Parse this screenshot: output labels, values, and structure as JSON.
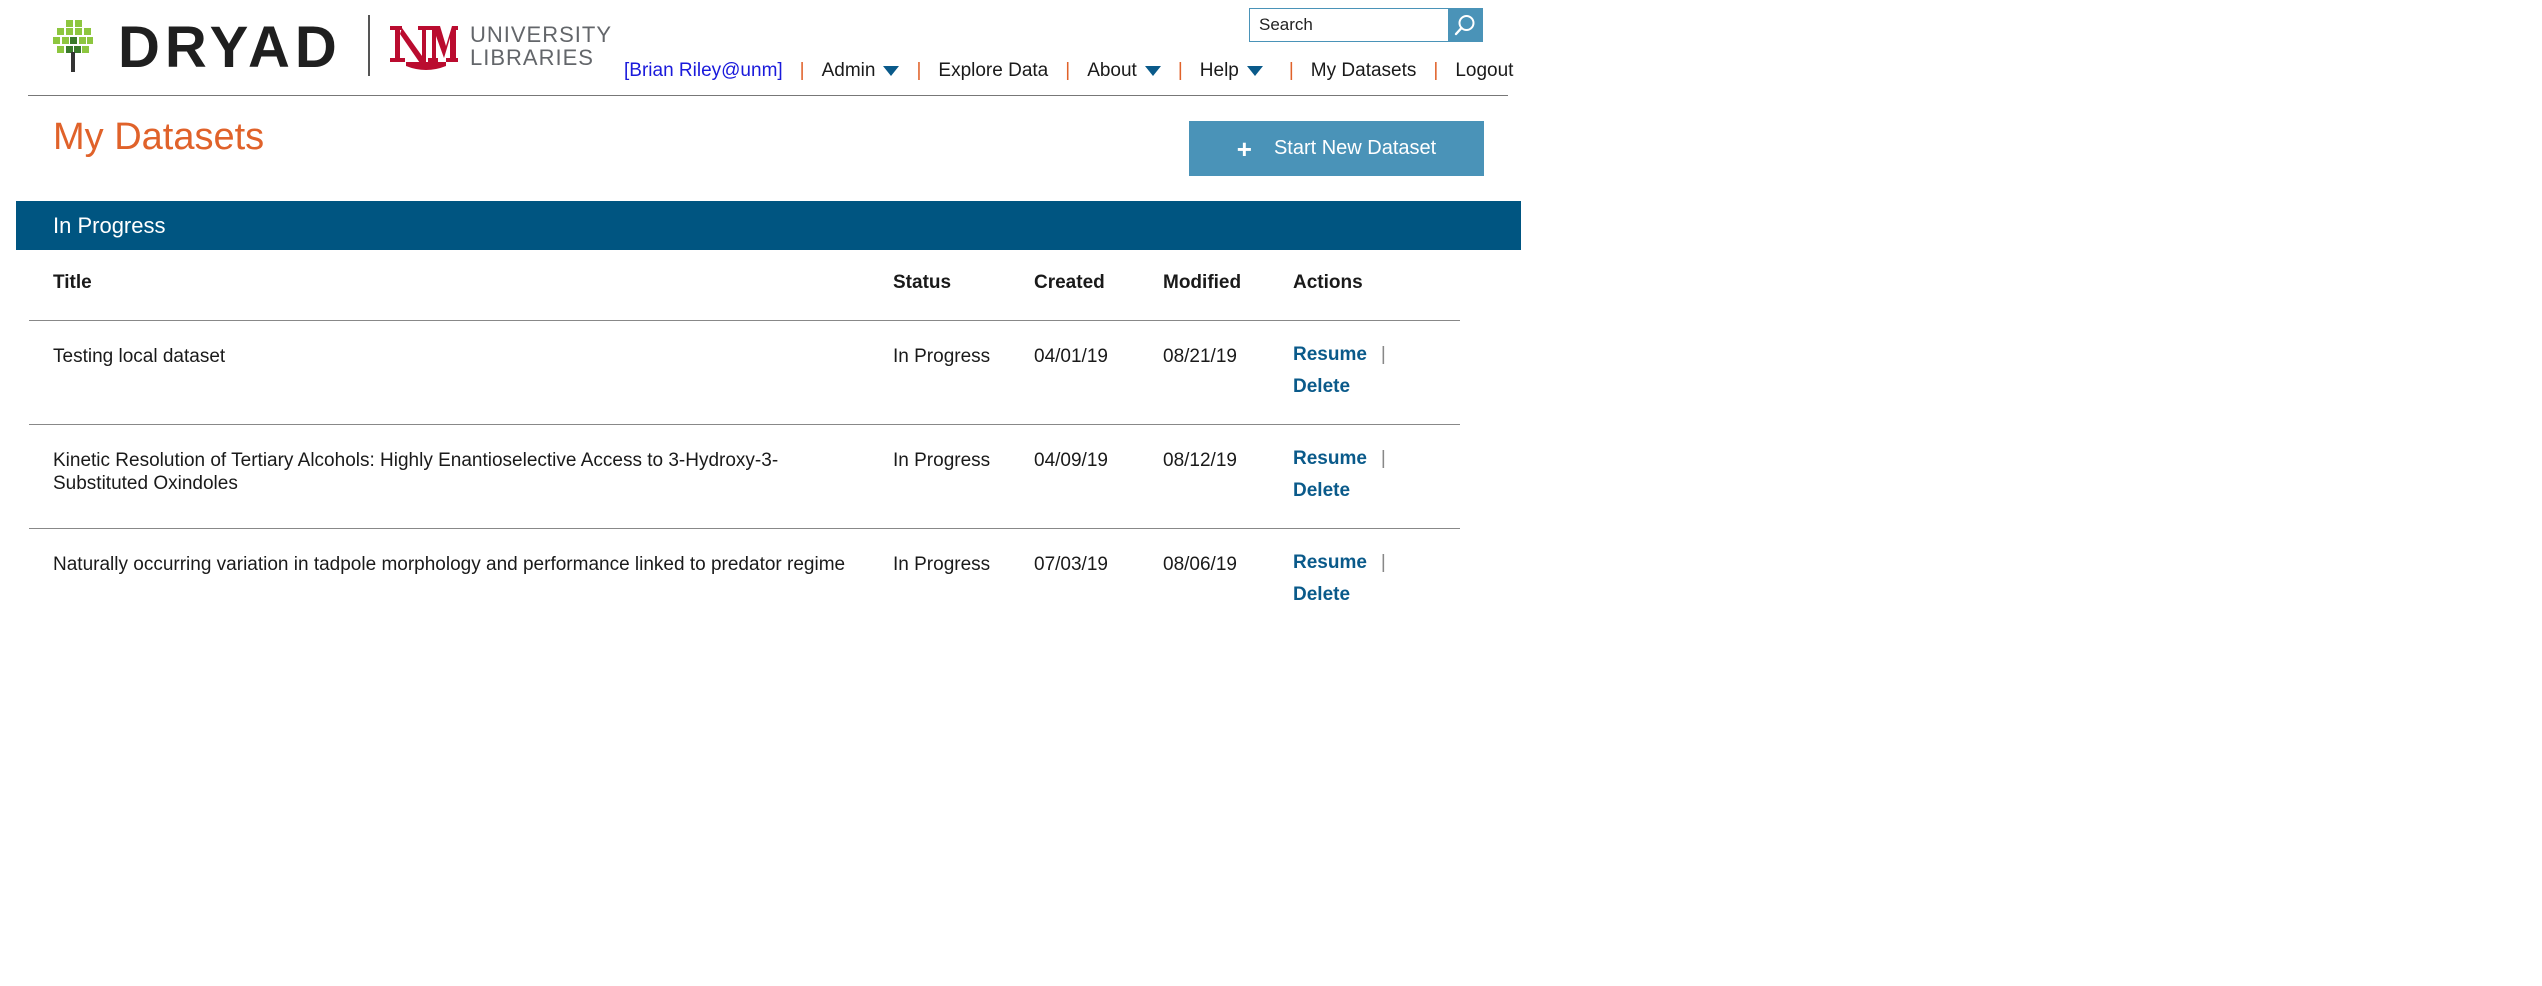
{
  "brand": {
    "name": "DRYAD",
    "partner_line1": "UNIVERSITY",
    "partner_line2": "LIBRARIES",
    "partner_mark_color": "#ba0c2f"
  },
  "search": {
    "placeholder": "Search"
  },
  "nav": {
    "user": "[Brian Riley@unm]",
    "items": [
      {
        "label": "Admin",
        "has_dropdown": true
      },
      {
        "label": "Explore Data",
        "has_dropdown": false
      },
      {
        "label": "About",
        "has_dropdown": true
      },
      {
        "label": "Help",
        "has_dropdown": true
      },
      {
        "label": "My Datasets",
        "has_dropdown": false
      },
      {
        "label": "Logout",
        "has_dropdown": false
      }
    ],
    "separator": "|"
  },
  "page": {
    "title": "My Datasets",
    "new_button_icon": "plus-icon",
    "new_button_label": "Start New Dataset"
  },
  "section": {
    "title": "In Progress",
    "columns": [
      "Title",
      "Status",
      "Created",
      "Modified",
      "Actions"
    ],
    "rows": [
      {
        "title": "Testing local dataset",
        "status": "In Progress",
        "created": "04/01/19",
        "modified": "08/21/19",
        "actions": [
          "Resume",
          "Delete"
        ]
      },
      {
        "title": "Kinetic Resolution of Tertiary Alcohols: Highly Enantioselective Access to 3-Hydroxy-3-Substituted Oxindoles",
        "status": "In Progress",
        "created": "04/09/19",
        "modified": "08/12/19",
        "actions": [
          "Resume",
          "Delete"
        ]
      },
      {
        "title": "Naturally occurring variation in tadpole morphology and performance linked to predator regime",
        "status": "In Progress",
        "created": "07/03/19",
        "modified": "08/06/19",
        "actions": [
          "Resume",
          "Delete"
        ]
      }
    ],
    "action_separator": "|"
  },
  "colors": {
    "accent_orange": "#e0622a",
    "section_blue": "#005581",
    "button_blue": "#4a93b8",
    "link_blue": "#0a5a8a",
    "user_blue": "#1a1adb"
  }
}
